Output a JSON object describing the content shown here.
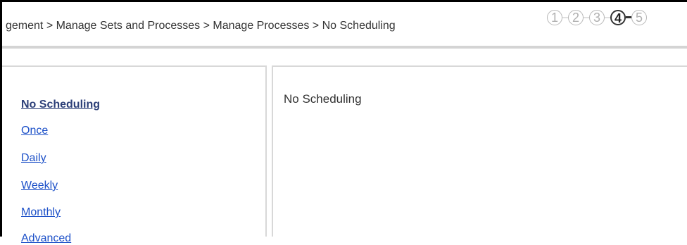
{
  "header": {
    "breadcrumb": "gement > Manage Sets and Processes > Manage Processes > No Scheduling",
    "steps": [
      {
        "label": "1",
        "state": "done"
      },
      {
        "label": "2",
        "state": "done"
      },
      {
        "label": "3",
        "state": "done"
      },
      {
        "label": "4",
        "state": "current"
      },
      {
        "label": "5",
        "state": "upcoming"
      }
    ]
  },
  "sidebar": {
    "items": [
      {
        "label": "No Scheduling",
        "selected": true
      },
      {
        "label": "Once",
        "selected": false
      },
      {
        "label": "Daily",
        "selected": false
      },
      {
        "label": "Weekly",
        "selected": false
      },
      {
        "label": "Monthly",
        "selected": false
      },
      {
        "label": "Advanced",
        "selected": false
      }
    ]
  },
  "main": {
    "title": "No Scheduling"
  },
  "colors": {
    "link": "#1c50c8",
    "selected_link": "#2c3f78",
    "text": "#333333",
    "divider": "#d4d4d4"
  }
}
